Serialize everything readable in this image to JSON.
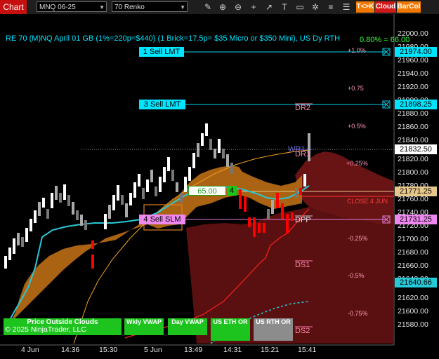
{
  "toolbar": {
    "chart_tab": "Chart",
    "instrument": "MNQ 06-25",
    "bar_type": "70 Renko",
    "tk_button": "T<>K",
    "cloud_button": "Cloud",
    "barcol_button": "BarCol",
    "icons": [
      "pencil-icon",
      "magnifier-icon",
      "zoom-out-icon",
      "crosshair-icon",
      "draw-line-icon",
      "text-icon",
      "data-box-icon",
      "settings-icon",
      "list-icon",
      "properties-icon",
      "screenshot-icon"
    ]
  },
  "chart": {
    "title": "RE 70 (M)NQ April 01 GB (1%=220p=$440) (1 Brick=17.5p= $35 Micro or $350 Mini), US Dy RTH",
    "title_pct": "0.80% = 66.00",
    "y_ticks": [
      "22000.00",
      "21980.00",
      "21960.00",
      "21940.00",
      "21920.00",
      "21900.00",
      "21880.00",
      "21860.00",
      "21840.00",
      "21820.00",
      "21800.00",
      "21780.00",
      "21760.00",
      "21740.00",
      "21720.00",
      "21700.00",
      "21680.00",
      "21660.00",
      "21640.00",
      "21620.00",
      "21600.00",
      "21580.00"
    ],
    "x_ticks": [
      "4 Jun",
      "14:36",
      "15:30",
      "5 Jun",
      "13:49",
      "14:31",
      "15:21",
      "15:41"
    ],
    "orders": [
      {
        "label": "1 Sell LMT",
        "price": "21974.00"
      },
      {
        "label": "3 Sell LMT",
        "price": "21898.25"
      },
      {
        "label": "4 Sell SLM",
        "price": "21731.25"
      }
    ],
    "last_price": "21832.50",
    "fill_price": "21771.25",
    "dash_price": "21640.66",
    "position": {
      "value": "65.00",
      "qty": "4"
    },
    "pct_levels": [
      "+1.0%",
      "+0.75",
      "+0.5%",
      "+0.25%",
      "-0.25%",
      "-0.5%",
      "-0.75%"
    ],
    "pivot_labels": [
      "DR2",
      "WR1",
      "DR1",
      "DPP",
      "DS1",
      "DS2"
    ],
    "close_label": "CLOSE 4 JUN",
    "copyright": "© 2025 NinjaTrader, LLC",
    "bottom_buttons": [
      {
        "label": "Price Outside Clouds",
        "color": "#1ec41e"
      },
      {
        "label": "Wkly VWAP",
        "color": "#1ec41e"
      },
      {
        "label": "Day VWAP",
        "color": "#1ec41e"
      },
      {
        "label": "US ETH OR",
        "color": "#1ec41e"
      },
      {
        "label": "US RTH OR",
        "color": "#8c8c8c"
      }
    ],
    "colors": {
      "up": "#ffffff",
      "down": "#ff0000",
      "cloud": "#c77a1a",
      "cloud_dark": "#7a1818",
      "ma_cyan": "#27c9d6",
      "ma_orange": "#f0a020",
      "order_cyan": "#00e5ff",
      "stop_magenta": "#e07fe0",
      "fill_tan": "#e8c88a"
    }
  }
}
